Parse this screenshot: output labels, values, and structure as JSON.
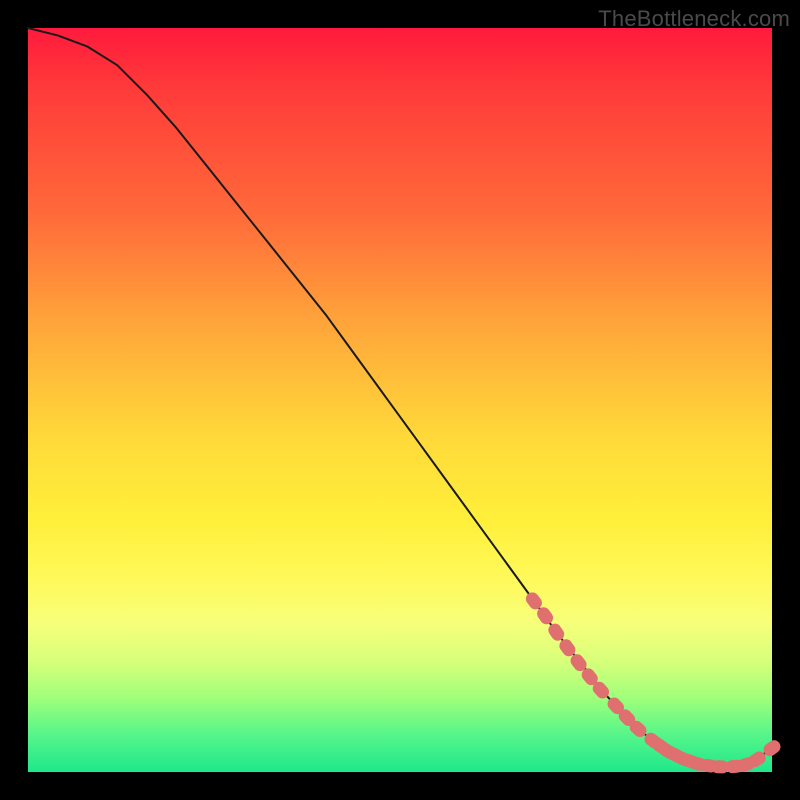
{
  "watermark": "TheBottleneck.com",
  "colors": {
    "curve_stroke": "#1a1a1a",
    "marker_fill": "#e07070",
    "marker_stroke": "#c85a5a"
  },
  "chart_data": {
    "type": "line",
    "title": "",
    "xlabel": "",
    "ylabel": "",
    "xlim": [
      0,
      100
    ],
    "ylim": [
      0,
      100
    ],
    "series": [
      {
        "name": "bottleneck-curve",
        "x": [
          0,
          4,
          8,
          12,
          16,
          20,
          24,
          28,
          32,
          36,
          40,
          44,
          48,
          52,
          56,
          60,
          64,
          68,
          70,
          72,
          74,
          76,
          78,
          80,
          82,
          84,
          86,
          88,
          90,
          92,
          94,
          96,
          98,
          100
        ],
        "y": [
          100,
          99,
          97.5,
          95,
          91,
          86.5,
          81.5,
          76.5,
          71.5,
          66.5,
          61.5,
          56,
          50.5,
          45,
          39.5,
          34,
          28.5,
          23,
          20.2,
          17.5,
          15,
          12.5,
          10,
          7.8,
          5.8,
          4.2,
          2.8,
          1.8,
          1.1,
          0.7,
          0.7,
          1.1,
          1.8,
          3.2
        ]
      }
    ],
    "markers": {
      "name": "highlight-points",
      "x": [
        68,
        69.5,
        71,
        72.5,
        74,
        75.5,
        77,
        79,
        80.5,
        82,
        84,
        85,
        86,
        87,
        88,
        89,
        90,
        91.5,
        93,
        95,
        96.5,
        98,
        100
      ],
      "y": [
        23,
        21,
        18.8,
        16.7,
        14.7,
        12.8,
        11,
        8.9,
        7.3,
        5.8,
        4.2,
        3.5,
        2.8,
        2.3,
        1.8,
        1.45,
        1.1,
        0.85,
        0.7,
        0.75,
        1.0,
        1.7,
        3.2
      ]
    }
  }
}
